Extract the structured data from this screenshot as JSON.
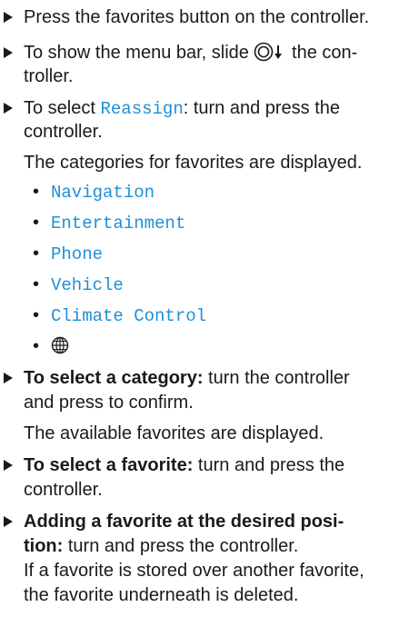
{
  "steps": [
    {
      "text": "Press the favorites button on the controller."
    },
    {
      "pre": "To show the menu bar, slide",
      "post": "the con-",
      "line2": "troller."
    },
    {
      "pre": "To select",
      "menu": "Reassign",
      "post": ": turn and press the",
      "line2": "controller.",
      "line3": "The categories for favorites are displayed."
    },
    {
      "bold": "To select a category:",
      "rest": "turn the controller",
      "line2": "and press to confirm.",
      "line3": "The available favorites are displayed."
    },
    {
      "bold": "To select a favorite:",
      "rest": "turn and press the",
      "line2": "controller."
    },
    {
      "bold": "Adding a favorite at the desired posi-",
      "line2_bold": "tion:",
      "line2_rest": "turn and press the controller.",
      "line3": "If a favorite is stored over another favorite,",
      "line4": "the favorite underneath is deleted."
    }
  ],
  "categories": [
    "Navigation",
    "Entertainment",
    "Phone",
    "Vehicle",
    "Climate Control"
  ],
  "icons": {
    "slide_down": "controller-slide-down-icon",
    "globe": "globe-icon"
  },
  "colors": {
    "menu_text": "#1f8fd6",
    "body_text": "#1a1a1a"
  }
}
